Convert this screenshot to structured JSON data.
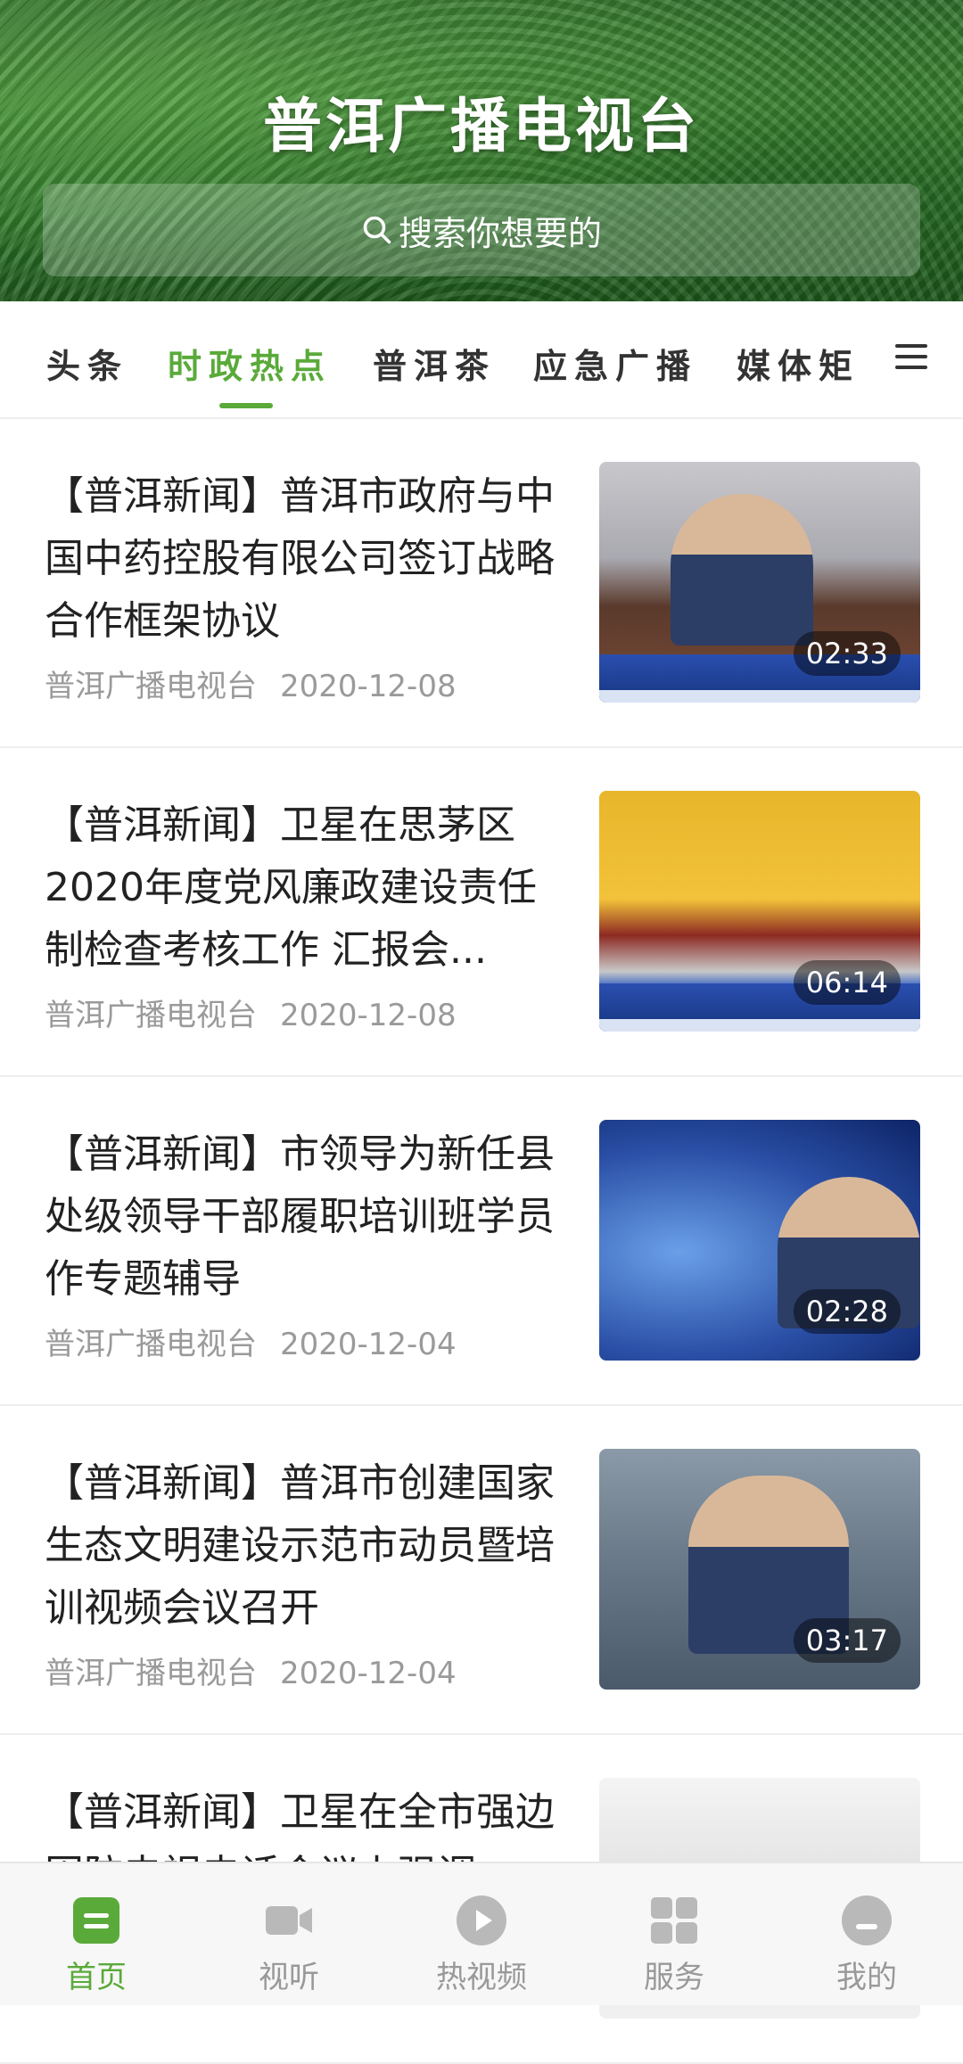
{
  "header": {
    "title": "普洱广播电视台",
    "search_placeholder": "搜索你想要的"
  },
  "tabs": [
    {
      "label": "头条",
      "active": false
    },
    {
      "label": "时政热点",
      "active": true
    },
    {
      "label": "普洱茶",
      "active": false
    },
    {
      "label": "应急广播",
      "active": false
    },
    {
      "label": "媒体矩",
      "active": false
    }
  ],
  "news": [
    {
      "title": "【普洱新闻】普洱市政府与中国中药控股有限公司签订战略合作框架协议",
      "source": "普洱广播电视台",
      "date": "2020-12-08",
      "duration": "02:33"
    },
    {
      "title": "【普洱新闻】卫星在思茅区2020年度党风廉政建设责任制检查考核工作 汇报会...",
      "source": "普洱广播电视台",
      "date": "2020-12-08",
      "duration": "06:14"
    },
    {
      "title": "【普洱新闻】市领导为新任县处级领导干部履职培训班学员作专题辅导",
      "source": "普洱广播电视台",
      "date": "2020-12-04",
      "duration": "02:28"
    },
    {
      "title": "【普洱新闻】普洱市创建国家生态文明建设示范市动员暨培训视频会议召开",
      "source": "普洱广播电视台",
      "date": "2020-12-04",
      "duration": "03:17"
    },
    {
      "title": "【普洱新闻】卫星在全市强边固防电视电话会议上强调",
      "source": "",
      "date": "",
      "duration": ""
    }
  ],
  "bottom_nav": [
    {
      "label": "首页",
      "icon": "home-icon",
      "active": true
    },
    {
      "label": "视听",
      "icon": "video-camera-icon",
      "active": false
    },
    {
      "label": "热视频",
      "icon": "play-circle-icon",
      "active": false
    },
    {
      "label": "服务",
      "icon": "grid-icon",
      "active": false
    },
    {
      "label": "我的",
      "icon": "user-icon",
      "active": false
    }
  ],
  "colors": {
    "accent": "#5aaa3a",
    "text": "#222222",
    "meta": "#9a9a9a",
    "nav_inactive": "#999999"
  }
}
